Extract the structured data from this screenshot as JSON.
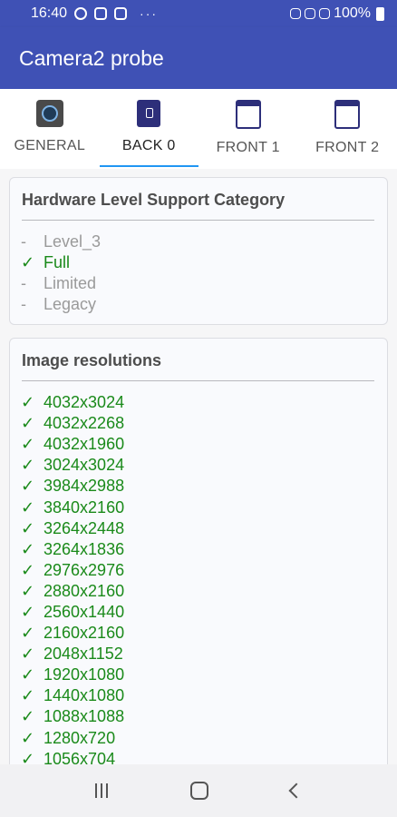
{
  "status_bar": {
    "time": "16:40",
    "battery": "100%",
    "overflow": "···"
  },
  "app_bar": {
    "title": "Camera2 probe"
  },
  "tabs": [
    {
      "label": "GENERAL",
      "icon": "camera-chip-icon",
      "active": false
    },
    {
      "label": "BACK 0",
      "icon": "phone-back-icon",
      "active": true
    },
    {
      "label": "FRONT 1",
      "icon": "phone-front-icon",
      "active": false
    },
    {
      "label": "FRONT 2",
      "icon": "phone-front-icon",
      "active": false
    }
  ],
  "hardware_card": {
    "title": "Hardware Level Support Category",
    "items": [
      {
        "mark": "-",
        "label": "Level_3",
        "supported": false
      },
      {
        "mark": "✓",
        "label": "Full",
        "supported": true
      },
      {
        "mark": "-",
        "label": "Limited",
        "supported": false
      },
      {
        "mark": "-",
        "label": "Legacy",
        "supported": false
      }
    ]
  },
  "resolutions_card": {
    "title": "Image resolutions",
    "items": [
      {
        "mark": "✓",
        "label": "4032x3024"
      },
      {
        "mark": "✓",
        "label": "4032x2268"
      },
      {
        "mark": "✓",
        "label": "4032x1960"
      },
      {
        "mark": "✓",
        "label": "3024x3024"
      },
      {
        "mark": "✓",
        "label": "3984x2988"
      },
      {
        "mark": "✓",
        "label": "3840x2160"
      },
      {
        "mark": "✓",
        "label": "3264x2448"
      },
      {
        "mark": "✓",
        "label": "3264x1836"
      },
      {
        "mark": "✓",
        "label": "2976x2976"
      },
      {
        "mark": "✓",
        "label": "2880x2160"
      },
      {
        "mark": "✓",
        "label": "2560x1440"
      },
      {
        "mark": "✓",
        "label": "2160x2160"
      },
      {
        "mark": "✓",
        "label": "2048x1152"
      },
      {
        "mark": "✓",
        "label": "1920x1080"
      },
      {
        "mark": "✓",
        "label": "1440x1080"
      },
      {
        "mark": "✓",
        "label": "1088x1088"
      },
      {
        "mark": "✓",
        "label": "1280x720"
      },
      {
        "mark": "✓",
        "label": "1056x704"
      }
    ]
  },
  "colors": {
    "primary": "#3f51b5",
    "tab_indicator": "#2196f3",
    "supported": "#1a8a1a",
    "unsupported": "#9a9a9a"
  }
}
